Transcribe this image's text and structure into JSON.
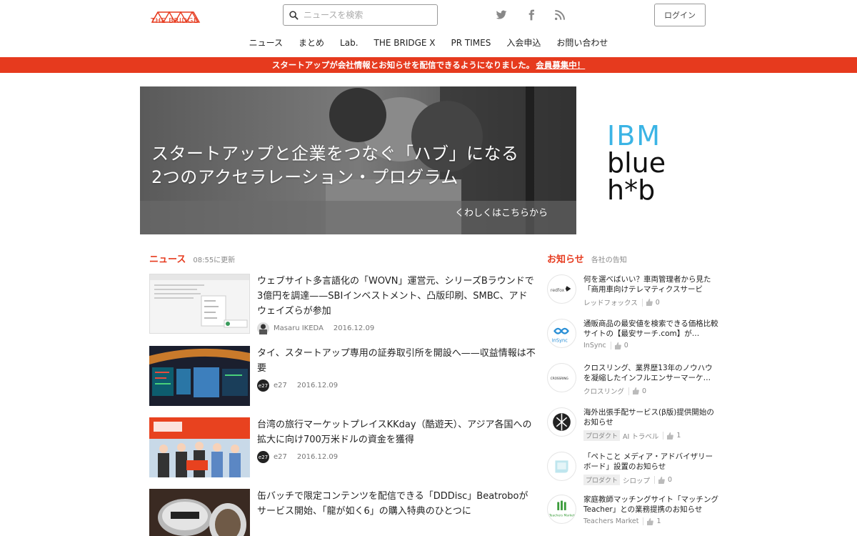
{
  "header": {
    "logo_text": "THE BRIDGE",
    "search_placeholder": "ニュースを検索",
    "login_label": "ログイン",
    "social_icons": [
      "twitter-icon",
      "facebook-icon",
      "rss-icon"
    ]
  },
  "nav": {
    "items": [
      "ニュース",
      "まとめ",
      "Lab.",
      "THE BRIDGE X",
      "PR TIMES",
      "入会申込",
      "お問い合わせ"
    ]
  },
  "announcement": {
    "text": "スタートアップが会社情報とお知らせを配信できるようになりました。",
    "link": "会員募集中！"
  },
  "hero": {
    "title_line1": "スタートアップと企業をつなぐ「ハブ」になる",
    "title_line2": "2つのアクセラレーション・プログラム",
    "more": "くわしくはこちらから"
  },
  "ad": {
    "line1": "IBM",
    "line2": "blue",
    "line3": "h*b"
  },
  "news": {
    "heading": "ニュース",
    "updated": "08:55に更新",
    "items": [
      {
        "title": "ウェブサイト多言語化の「WOVN」運営元、シリーズBラウンドで3億円を調達——SBIインベストメント、凸版印刷、SMBC、アドウェイズらが参加",
        "author": "Masaru IKEDA",
        "date": "2016.12.09"
      },
      {
        "title": "タイ、スタートアップ専用の証券取引所を開設へ——収益情報は不要",
        "author": "e27",
        "date": "2016.12.09"
      },
      {
        "title": "台湾の旅行マーケットプレイスKKday（酷遊天）、アジア各国への拡大に向け700万米ドルの資金を獲得",
        "author": "e27",
        "date": "2016.12.09"
      },
      {
        "title": "缶バッチで限定コンテンツを配信できる「DDDisc」Beatroboがサービス開始、「龍が如く6」の購入特典のひとつに",
        "author": "",
        "date": ""
      }
    ]
  },
  "notices": {
    "heading": "お知らせ",
    "sub": "各社の告知",
    "items": [
      {
        "title": "何を選べばいい？車両管理者から見た「商用車向けテレマティクスサービ",
        "company": "レッドフォックス",
        "tags": [],
        "likes": "0",
        "logo": "redfox"
      },
      {
        "title": "通販商品の最安値を検索できる価格比較サイトの【最安サーチ.com】が…",
        "company": "InSync",
        "tags": [],
        "likes": "0",
        "logo": "InSync"
      },
      {
        "title": "クロスリング、業界歴13年のノウハウを凝縮したインフルエンサーマーケ…",
        "company": "クロスリング",
        "tags": [],
        "likes": "0",
        "logo": "CROSSRING"
      },
      {
        "title": "海外出張手配サービス(β版)提供開始のお知らせ",
        "company": "AI トラベル",
        "tags": [
          "プロダクト"
        ],
        "likes": "1",
        "logo": ""
      },
      {
        "title": "「ペトこと メディア・アドバイザリーボード」設置のお知らせ",
        "company": "シロップ",
        "tags": [
          "プロダクト"
        ],
        "likes": "0",
        "logo": ""
      },
      {
        "title": "家庭教師マッチングサイト「マッチングTeacher」との業務提携のお知らせ",
        "company": "Teachers Market",
        "tags": [],
        "likes": "1",
        "logo": "Teachers Market"
      }
    ]
  },
  "colors": {
    "accent": "#e63a1e",
    "ibm_blue": "#3bb4e5"
  }
}
